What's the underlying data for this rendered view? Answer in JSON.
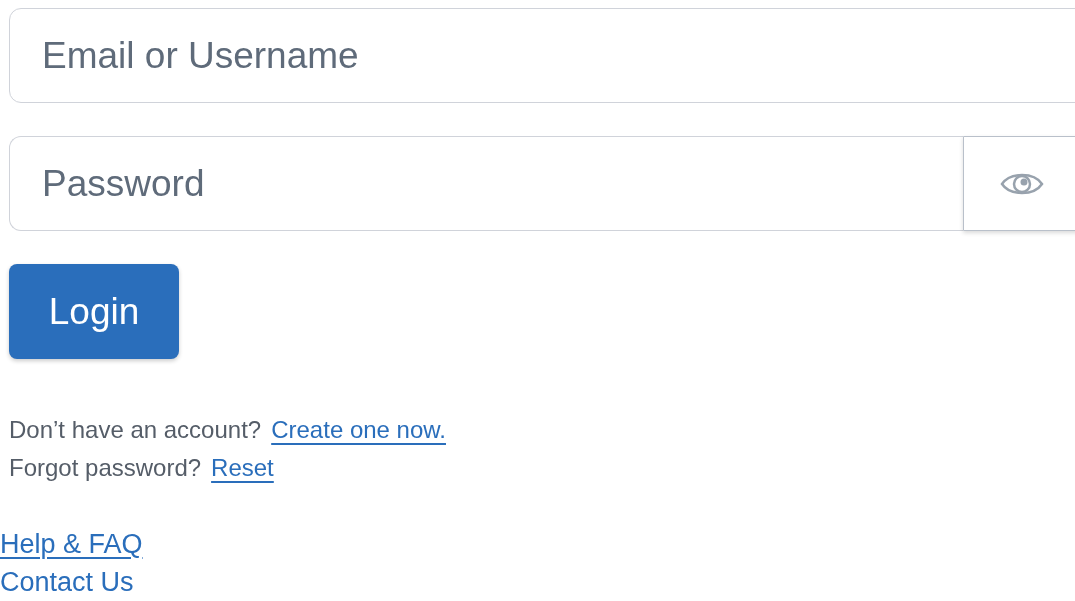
{
  "email_field": {
    "placeholder": "Email or Username"
  },
  "password_field": {
    "placeholder": "Password"
  },
  "login_button": {
    "label": "Login"
  },
  "account_prompts": [
    {
      "text": "Don’t have an account?",
      "link": "Create one now."
    },
    {
      "text": "Forgot password?",
      "link": "Reset"
    }
  ],
  "footer_links": [
    "Help & FAQ",
    "Contact Us"
  ]
}
